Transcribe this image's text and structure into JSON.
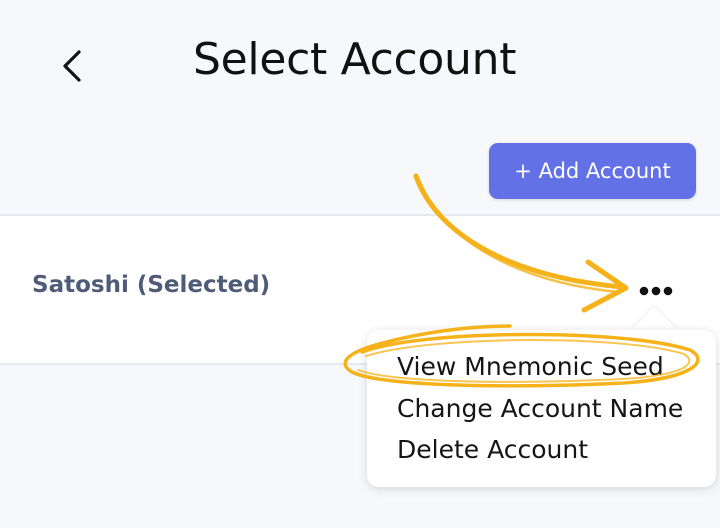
{
  "header": {
    "title": "Select Account",
    "back_icon": "chevron-left-icon"
  },
  "toolbar": {
    "add_account_label": "+ Add Account",
    "accent_color": "#6271e6"
  },
  "accounts": [
    {
      "name": "Satoshi (Selected)",
      "selected": true
    }
  ],
  "account_menu": {
    "trigger_icon": "more-horizontal-icon",
    "items": [
      {
        "label": "View Mnemonic Seed",
        "highlighted": true
      },
      {
        "label": "Change Account Name"
      },
      {
        "label": "Delete Account"
      }
    ]
  },
  "annotation": {
    "color": "#f5b21a",
    "icon": "hand-drawn-arrow-icon"
  }
}
